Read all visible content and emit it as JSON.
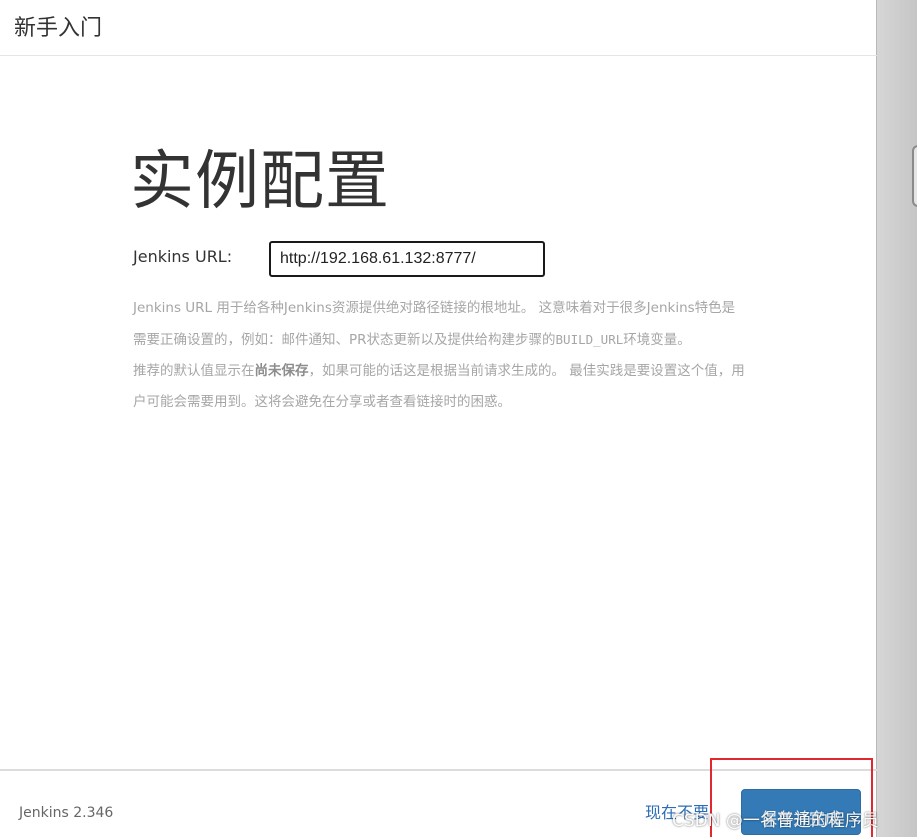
{
  "header": {
    "title": "新手入门"
  },
  "main": {
    "heading": "实例配置",
    "url_label": "Jenkins URL:",
    "url_value": "http://192.168.61.132:8777/",
    "help": {
      "p1_a": "Jenkins URL 用于给各种Jenkins资源提供绝对路径链接的根地址。 这意味着对于很多Jenkins特色是需要正确设置的，例如：邮件通知、PR状态更新以及提供给构建步骤的",
      "p1_code": "BUILD_URL",
      "p1_b": "环境变量。",
      "p2_a": "推荐的默认值显示在",
      "p2_strong": "尚未保存",
      "p2_b": "，如果可能的话这是根据当前请求生成的。 最佳实践是要设置这个值，用户可能会需要用到。这将会避免在分享或者查看链接时的困惑。"
    }
  },
  "footer": {
    "version": "Jenkins 2.346",
    "skip_label": "现在不要",
    "save_label": "保存并完成"
  },
  "watermark": "CSDN @一名普通的程序员",
  "colors": {
    "primary_button": "#337ab7",
    "link": "#2d6db6",
    "annotation_box": "#e0282e"
  }
}
